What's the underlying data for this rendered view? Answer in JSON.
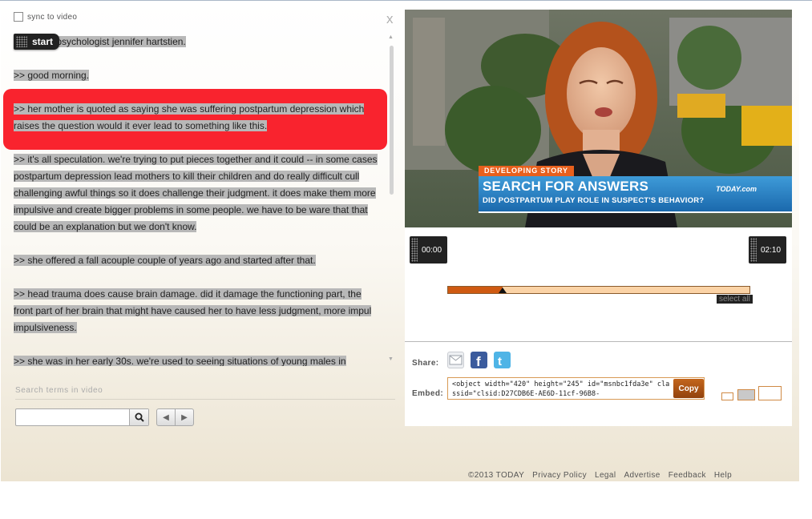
{
  "sync": {
    "label": "sync to video",
    "checked": false
  },
  "close_label": "x",
  "start_label": "start",
  "transcript": {
    "paragraphs": [
      "f this with psychologist jennifer hartstien.",
      ">> good morning.",
      ">> her mother is quoted as saying she was suffering postpartum depression which raises the question would it ever lead to something like this.",
      ">> it's all speculation. we're trying to put pieces together and it could -- in some cases postpartum depression lead mothers to kill their children and do really difficult cull challenging awful things so it does challenge their judgment. it does make them more impulsive and create bigger problems in some people. we have to be ware that that could be an explanation but we don't know.",
      ">> she offered a fall acouple couple of years ago and started after that.",
      ">> head trauma does cause brain damage. did it damage the functioning part, the front part of her brain that might have caused her to have less judgment, more impul impulsiveness.",
      ">> she was in her early 30s. we're used to seeing situations of young males in"
    ],
    "current_index": 2
  },
  "search": {
    "label": "Search terms in video",
    "placeholder": ""
  },
  "video": {
    "tag": "DEVELOPING STORY",
    "headline": "SEARCH FOR ANSWERS",
    "subhead": "DID POSTPARTUM PLAY ROLE IN SUSPECT'S BEHAVIOR?",
    "logo": "TODAY.com"
  },
  "player": {
    "start_time": "00:00",
    "end_time": "02:10",
    "progress_fraction": 0.18,
    "select_all": "select all"
  },
  "share": {
    "label": "Share:",
    "icons": [
      "email-icon",
      "facebook-icon",
      "twitter-icon"
    ]
  },
  "embed": {
    "label": "Embed:",
    "copy_label": "Copy",
    "code": "<object width=\"420\" height=\"245\" id=\"msnbc1fda3e\" classid=\"clsid:D27CDB6E-AE6D-11cf-96B8-"
  },
  "footer": [
    "©2013 TODAY",
    "Privacy Policy",
    "Legal",
    "Advertise",
    "Feedback",
    "Help"
  ],
  "colors": {
    "highlight": "#f9232e",
    "progress_fill": "#cf5a12",
    "progress_track": "#fbd3a6",
    "lower_third_blue": "#1b69ad",
    "tag_orange": "#e8601d"
  }
}
